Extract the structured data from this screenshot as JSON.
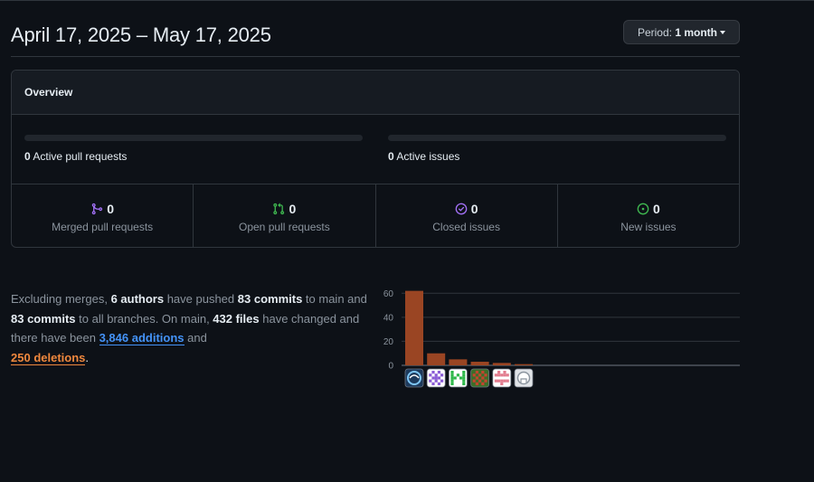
{
  "header": {
    "title": "April 17, 2025 – May 17, 2025",
    "period_prefix": "Period: ",
    "period_value": "1 month"
  },
  "overview": {
    "title": "Overview",
    "active_prs": {
      "count": "0",
      "label": " Active pull requests",
      "fill_fraction": 0
    },
    "active_issues": {
      "count": "0",
      "label": " Active issues",
      "fill_fraction": 0
    },
    "stats": [
      {
        "icon": "merge-icon",
        "color": "#a371f7",
        "value": "0",
        "label": "Merged pull requests"
      },
      {
        "icon": "pull-request-icon",
        "color": "#3fb950",
        "value": "0",
        "label": "Open pull requests"
      },
      {
        "icon": "issue-closed-icon",
        "color": "#a371f7",
        "value": "0",
        "label": "Closed issues"
      },
      {
        "icon": "issue-opened-icon",
        "color": "#3fb950",
        "value": "0",
        "label": "New issues"
      }
    ]
  },
  "summary": {
    "t1": "Excluding merges, ",
    "authors": "6 authors",
    "t2": " have pushed ",
    "commits_main": "83 commits",
    "t3": " to main and ",
    "commits_all": "83 commits",
    "t4": " to all branches. On main, ",
    "files": "432 files",
    "t5": " have changed and there have been ",
    "additions_num": "3,846",
    "additions_word": " additions",
    "t6": " and",
    "deletions_num": "250",
    "deletions_word": " deletions",
    "t7": "."
  },
  "chart_data": {
    "type": "bar",
    "categories": [
      "author-1",
      "author-2",
      "author-3",
      "author-4",
      "author-5",
      "author-6"
    ],
    "values": [
      62,
      10,
      5,
      3,
      2,
      1
    ],
    "ylim": [
      0,
      70
    ],
    "yticks": [
      0,
      20,
      40,
      60
    ],
    "bar_color": "#9a4523",
    "grid": true
  }
}
